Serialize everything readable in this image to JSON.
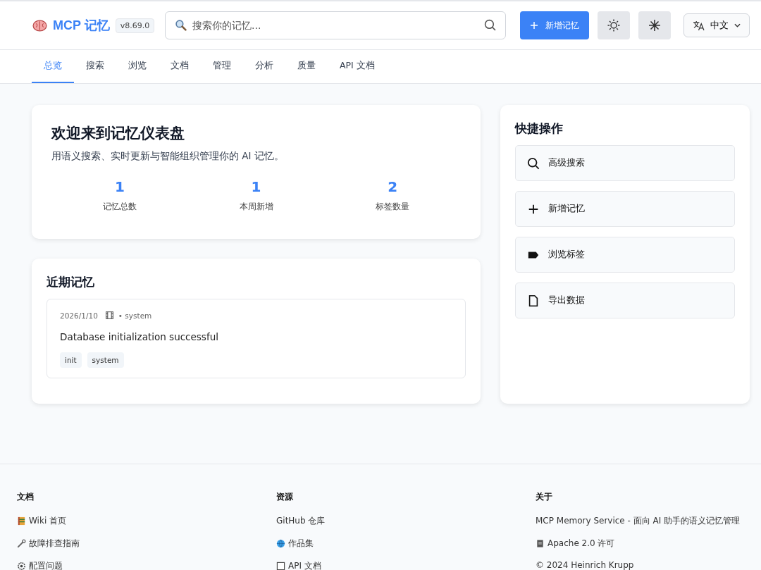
{
  "header": {
    "brand": "MCP 记忆",
    "version": "v8.69.0",
    "search": {
      "placeholder": "搜索你的记忆..."
    },
    "add_button": "新增记忆",
    "language": "中文"
  },
  "tabs": [
    {
      "label": "总览",
      "selected": true
    },
    {
      "label": "搜索",
      "selected": false
    },
    {
      "label": "浏览",
      "selected": false
    },
    {
      "label": "文档",
      "selected": false
    },
    {
      "label": "管理",
      "selected": false
    },
    {
      "label": "分析",
      "selected": false
    },
    {
      "label": "质量",
      "selected": false
    },
    {
      "label": "API 文档",
      "selected": false
    }
  ],
  "welcome": {
    "title": "欢迎来到记忆仪表盘",
    "subtitle": "用语义搜索、实时更新与智能组织管理你的 AI 记忆。",
    "stats": [
      {
        "value": "1",
        "label": "记忆总数"
      },
      {
        "value": "1",
        "label": "本周新增"
      },
      {
        "value": "2",
        "label": "标签数量"
      }
    ]
  },
  "recent": {
    "title": "近期记忆",
    "items": [
      {
        "date": "2026/1/10",
        "source": "• system",
        "content": "Database initialization successful",
        "tags": [
          "init",
          "system"
        ]
      }
    ]
  },
  "quick_actions": {
    "title": "快捷操作",
    "items": [
      {
        "kind": "search",
        "label": "高级搜索"
      },
      {
        "kind": "plus",
        "label": "新增记忆"
      },
      {
        "kind": "tag",
        "label": "浏览标签"
      },
      {
        "kind": "file",
        "label": "导出数据"
      }
    ]
  },
  "footer": {
    "columns": [
      {
        "title": "文档",
        "links": [
          {
            "kind": "book",
            "label": "Wiki 首页"
          },
          {
            "kind": "wrench",
            "label": "故障排查指南"
          },
          {
            "kind": "gear",
            "label": "配置问题"
          }
        ]
      },
      {
        "title": "资源",
        "links": [
          {
            "kind": "none",
            "label": "GitHub 仓库"
          },
          {
            "kind": "globe",
            "label": "作品集"
          },
          {
            "kind": "window",
            "label": "API 文档"
          }
        ]
      },
      {
        "title": "关于",
        "links": [
          {
            "kind": "text",
            "label": "MCP Memory Service - 面向 AI 助手的语义记忆管理"
          },
          {
            "kind": "doc",
            "label": "Apache 2.0 许可"
          },
          {
            "kind": "text",
            "label": "© 2024 Heinrich Krupp"
          }
        ]
      }
    ]
  }
}
